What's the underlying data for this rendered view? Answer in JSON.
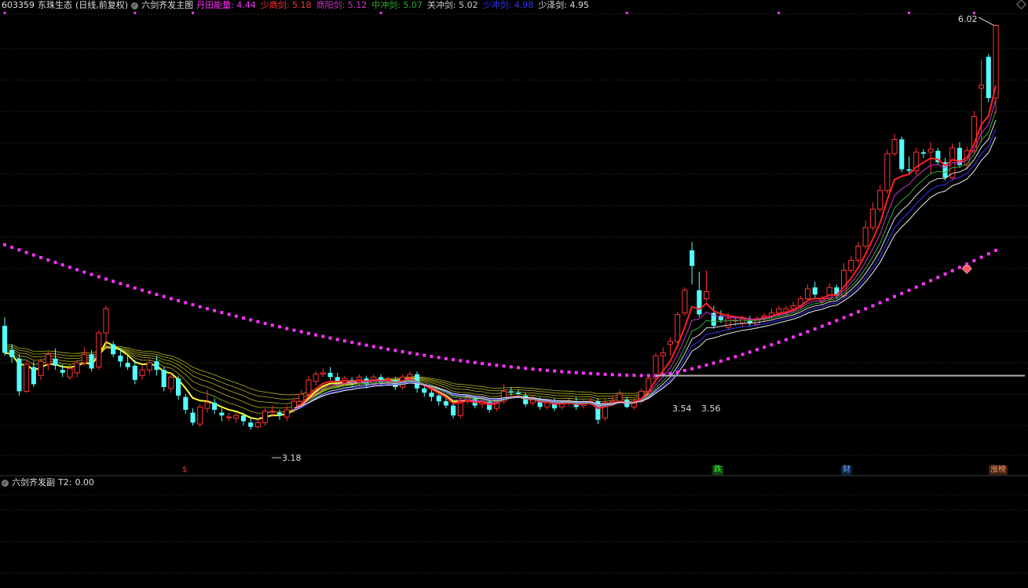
{
  "header": {
    "code": "603359",
    "name": "东珠生态",
    "period": "(日线,前复权)",
    "indicator_name": "六剑齐发主图",
    "metrics": [
      {
        "label": "丹田能量:",
        "value": "4.44",
        "color": "#ff33ff"
      },
      {
        "label": "少商剑:",
        "value": "5.18",
        "color": "#ff3333"
      },
      {
        "label": "商阳剑:",
        "value": "5.12",
        "color": "#cc33cc"
      },
      {
        "label": "中冲剑:",
        "value": "5.07",
        "color": "#33aa33"
      },
      {
        "label": "关冲剑:",
        "value": "5.02",
        "color": "#cccccc"
      },
      {
        "label": "少冲剑:",
        "value": "4.98",
        "color": "#3333ff"
      },
      {
        "label": "少泽剑:",
        "value": "4.95",
        "color": "#dddddd"
      }
    ]
  },
  "sub_header": {
    "indicator_name": "六剑齐发副",
    "metric_label": "T2:",
    "metric_value": "0.00"
  },
  "colors": {
    "up": "#ff3333",
    "down": "#54ffff",
    "dots": "#ff33ff",
    "ribbon": "#ffff33",
    "support_line": "#b0b0b0"
  },
  "chart_data": {
    "type": "candlestick",
    "ylim": [
      3.0,
      6.1
    ],
    "annotations": [
      {
        "text": "6.02",
        "type": "high"
      },
      {
        "text": "3.18",
        "type": "low"
      },
      {
        "text": "3.54",
        "type": "level"
      },
      {
        "text": "3.56",
        "type": "level"
      }
    ],
    "markers": [
      {
        "text": "$",
        "color": "#ff3333"
      },
      {
        "text": "跌",
        "color": "#33ff33",
        "bg": "#114411"
      },
      {
        "text": "财",
        "color": "#66aaff",
        "bg": "#112244"
      },
      {
        "text": "涨榜",
        "color": "#ff9966",
        "bg": "#442211"
      }
    ],
    "candles": [
      [
        3.91,
        3.72,
        3.97,
        3.7
      ],
      [
        3.74,
        3.69,
        3.78,
        3.65
      ],
      [
        3.68,
        3.45,
        3.71,
        3.42
      ],
      [
        3.45,
        3.64,
        3.66,
        3.44
      ],
      [
        3.62,
        3.5,
        3.66,
        3.48
      ],
      [
        3.56,
        3.66,
        3.68,
        3.53
      ],
      [
        3.64,
        3.71,
        3.73,
        3.6
      ],
      [
        3.68,
        3.63,
        3.75,
        3.6
      ],
      [
        3.6,
        3.58,
        3.64,
        3.55
      ],
      [
        3.55,
        3.61,
        3.64,
        3.53
      ],
      [
        3.58,
        3.65,
        3.67,
        3.55
      ],
      [
        3.65,
        3.71,
        3.76,
        3.63
      ],
      [
        3.71,
        3.61,
        3.74,
        3.59
      ],
      [
        3.62,
        3.86,
        3.88,
        3.6
      ],
      [
        3.86,
        4.03,
        4.05,
        3.75
      ],
      [
        3.78,
        3.71,
        3.8,
        3.69
      ],
      [
        3.7,
        3.66,
        3.75,
        3.62
      ],
      [
        3.65,
        3.62,
        3.7,
        3.6
      ],
      [
        3.63,
        3.53,
        3.67,
        3.5
      ],
      [
        3.56,
        3.6,
        3.63,
        3.53
      ],
      [
        3.6,
        3.65,
        3.68,
        3.57
      ],
      [
        3.66,
        3.6,
        3.7,
        3.56
      ],
      [
        3.6,
        3.48,
        3.62,
        3.45
      ],
      [
        3.47,
        3.55,
        3.58,
        3.44
      ],
      [
        3.54,
        3.42,
        3.56,
        3.39
      ],
      [
        3.41,
        3.32,
        3.43,
        3.29
      ],
      [
        3.3,
        3.23,
        3.33,
        3.21
      ],
      [
        3.22,
        3.34,
        3.36,
        3.2
      ],
      [
        3.33,
        3.37,
        3.46,
        3.3
      ],
      [
        3.37,
        3.32,
        3.4,
        3.29
      ],
      [
        3.3,
        3.28,
        3.33,
        3.24
      ],
      [
        3.27,
        3.27,
        3.3,
        3.24
      ],
      [
        3.26,
        3.28,
        3.3,
        3.23
      ],
      [
        3.28,
        3.24,
        3.3,
        3.21
      ],
      [
        3.23,
        3.2,
        3.26,
        3.18
      ],
      [
        3.2,
        3.23,
        3.26,
        3.19
      ],
      [
        3.23,
        3.31,
        3.33,
        3.21
      ],
      [
        3.31,
        3.31,
        3.35,
        3.27
      ],
      [
        3.3,
        3.28,
        3.32,
        3.25
      ],
      [
        3.27,
        3.32,
        3.35,
        3.24
      ],
      [
        3.32,
        3.38,
        3.4,
        3.3
      ],
      [
        3.38,
        3.43,
        3.46,
        3.36
      ],
      [
        3.43,
        3.53,
        3.56,
        3.41
      ],
      [
        3.52,
        3.57,
        3.59,
        3.49
      ],
      [
        3.57,
        3.58,
        3.61,
        3.55
      ],
      [
        3.58,
        3.55,
        3.62,
        3.53
      ],
      [
        3.55,
        3.51,
        3.58,
        3.49
      ],
      [
        3.51,
        3.54,
        3.56,
        3.49
      ],
      [
        3.53,
        3.51,
        3.55,
        3.48
      ],
      [
        3.51,
        3.55,
        3.57,
        3.49
      ],
      [
        3.54,
        3.5,
        3.56,
        3.47
      ],
      [
        3.5,
        3.55,
        3.57,
        3.48
      ],
      [
        3.55,
        3.51,
        3.57,
        3.49
      ],
      [
        3.51,
        3.53,
        3.55,
        3.49
      ],
      [
        3.53,
        3.48,
        3.55,
        3.46
      ],
      [
        3.48,
        3.55,
        3.57,
        3.46
      ],
      [
        3.55,
        3.57,
        3.59,
        3.53
      ],
      [
        3.57,
        3.47,
        3.59,
        3.44
      ],
      [
        3.47,
        3.44,
        3.49,
        3.41
      ],
      [
        3.44,
        3.41,
        3.46,
        3.38
      ],
      [
        3.42,
        3.38,
        3.44,
        3.35
      ],
      [
        3.38,
        3.35,
        3.4,
        3.33
      ],
      [
        3.35,
        3.28,
        3.37,
        3.26
      ],
      [
        3.28,
        3.38,
        3.4,
        3.26
      ],
      [
        3.38,
        3.41,
        3.43,
        3.36
      ],
      [
        3.4,
        3.35,
        3.42,
        3.33
      ],
      [
        3.36,
        3.38,
        3.4,
        3.33
      ],
      [
        3.38,
        3.32,
        3.4,
        3.3
      ],
      [
        3.33,
        3.38,
        3.4,
        3.31
      ],
      [
        3.38,
        3.45,
        3.5,
        3.36
      ],
      [
        3.45,
        3.44,
        3.48,
        3.42
      ],
      [
        3.44,
        3.43,
        3.46,
        3.41
      ],
      [
        3.42,
        3.36,
        3.44,
        3.34
      ],
      [
        3.37,
        3.39,
        3.42,
        3.35
      ],
      [
        3.39,
        3.34,
        3.41,
        3.32
      ],
      [
        3.34,
        3.37,
        3.39,
        3.32
      ],
      [
        3.37,
        3.33,
        3.4,
        3.31
      ],
      [
        3.34,
        3.37,
        3.39,
        3.32
      ],
      [
        3.37,
        3.38,
        3.4,
        3.35
      ],
      [
        3.38,
        3.34,
        3.41,
        3.32
      ],
      [
        3.35,
        3.37,
        3.39,
        3.33
      ],
      [
        3.37,
        3.38,
        3.4,
        3.35
      ],
      [
        3.38,
        3.25,
        3.4,
        3.22
      ],
      [
        3.26,
        3.37,
        3.4,
        3.24
      ],
      [
        3.37,
        3.38,
        3.42,
        3.35
      ],
      [
        3.38,
        3.43,
        3.46,
        3.36
      ],
      [
        3.39,
        3.34,
        3.41,
        3.33
      ],
      [
        3.34,
        3.38,
        3.4,
        3.32
      ],
      [
        3.38,
        3.45,
        3.47,
        3.36
      ],
      [
        3.45,
        3.54,
        3.56,
        3.44
      ],
      [
        3.54,
        3.7,
        3.72,
        3.53
      ],
      [
        3.7,
        3.72,
        3.76,
        3.56
      ],
      [
        3.78,
        3.8,
        3.83,
        3.7
      ],
      [
        3.8,
        3.99,
        4.01,
        3.79
      ],
      [
        4.0,
        4.16,
        4.18,
        3.98
      ],
      [
        4.44,
        4.33,
        4.5,
        4.2
      ],
      [
        4.16,
        3.99,
        4.29,
        3.97
      ],
      [
        4.1,
        4.15,
        4.3,
        4.08
      ],
      [
        4.0,
        3.91,
        4.05,
        3.89
      ],
      [
        3.98,
        3.95,
        4.02,
        3.93
      ],
      [
        3.9,
        3.96,
        4.0,
        3.88
      ],
      [
        3.95,
        3.95,
        3.98,
        3.91
      ],
      [
        3.93,
        3.96,
        3.98,
        3.9
      ],
      [
        3.95,
        3.93,
        3.98,
        3.91
      ],
      [
        3.92,
        3.96,
        3.98,
        3.91
      ],
      [
        3.97,
        3.98,
        4.0,
        3.94
      ],
      [
        3.98,
        4.0,
        4.03,
        3.96
      ],
      [
        4.0,
        4.03,
        4.05,
        3.98
      ],
      [
        4.0,
        4.03,
        4.05,
        3.98
      ],
      [
        4.03,
        4.05,
        4.08,
        4.01
      ],
      [
        4.05,
        4.1,
        4.12,
        4.03
      ],
      [
        4.1,
        4.17,
        4.2,
        4.08
      ],
      [
        4.18,
        4.13,
        4.22,
        4.1
      ],
      [
        4.08,
        4.1,
        4.12,
        4.06
      ],
      [
        4.1,
        4.18,
        4.21,
        4.08
      ],
      [
        4.18,
        4.12,
        4.2,
        4.1
      ],
      [
        4.12,
        4.3,
        4.35,
        4.1
      ],
      [
        4.3,
        4.37,
        4.4,
        4.28
      ],
      [
        4.37,
        4.47,
        4.5,
        4.35
      ],
      [
        4.47,
        4.6,
        4.65,
        4.45
      ],
      [
        4.6,
        4.73,
        4.78,
        4.58
      ],
      [
        4.73,
        4.86,
        4.9,
        4.71
      ],
      [
        4.86,
        5.12,
        5.15,
        4.84
      ],
      [
        5.12,
        5.22,
        5.26,
        5.1
      ],
      [
        5.22,
        5.01,
        5.24,
        4.99
      ],
      [
        5.01,
        5.0,
        5.1,
        4.98
      ],
      [
        5.0,
        5.13,
        5.16,
        4.97
      ],
      [
        5.13,
        5.12,
        5.15,
        5.09
      ],
      [
        5.13,
        5.15,
        5.2,
        4.98
      ],
      [
        5.14,
        5.06,
        5.16,
        5.04
      ],
      [
        5.06,
        4.95,
        5.09,
        4.93
      ],
      [
        4.95,
        5.16,
        5.19,
        4.93
      ],
      [
        5.16,
        5.04,
        5.2,
        5.02
      ],
      [
        5.04,
        5.14,
        5.17,
        5.01
      ],
      [
        5.14,
        5.38,
        5.42,
        5.12
      ],
      [
        5.58,
        5.6,
        5.78,
        5.2
      ],
      [
        5.8,
        5.51,
        5.82,
        5.48
      ],
      [
        5.51,
        6.02,
        6.03,
        5.4
      ]
    ],
    "sub_values": [
      0,
      0,
      0,
      0,
      0,
      0,
      0,
      0,
      0,
      0,
      0,
      0,
      0,
      0,
      0,
      0,
      0,
      0,
      0,
      0,
      0,
      0,
      0,
      0,
      0,
      0,
      0,
      0,
      0,
      0,
      0,
      0,
      0,
      0,
      0,
      0,
      0,
      0,
      0,
      0,
      0,
      0,
      0,
      0,
      0,
      0,
      0,
      0,
      0,
      0,
      0,
      0,
      0,
      0,
      0,
      0,
      0,
      0,
      0,
      0,
      0,
      0,
      0,
      0,
      0,
      0,
      0,
      0,
      0,
      0,
      0,
      0,
      0,
      0,
      0,
      0,
      0,
      0,
      0,
      0,
      0,
      0,
      0,
      0,
      0,
      0,
      0,
      0,
      0,
      0,
      0,
      0,
      0,
      0,
      0,
      0,
      0,
      0,
      0,
      0,
      0,
      0,
      0,
      0,
      0,
      0,
      0,
      0,
      0,
      0,
      0,
      0,
      0,
      0,
      0,
      0,
      0,
      0,
      0,
      0,
      0,
      0,
      0,
      0,
      0,
      0,
      0,
      0,
      0,
      0,
      0,
      0,
      0,
      0,
      0,
      0,
      0,
      0,
      0,
      0,
      0,
      0,
      0,
      0,
      0,
      0,
      0,
      1,
      0,
      0,
      0,
      0
    ]
  }
}
